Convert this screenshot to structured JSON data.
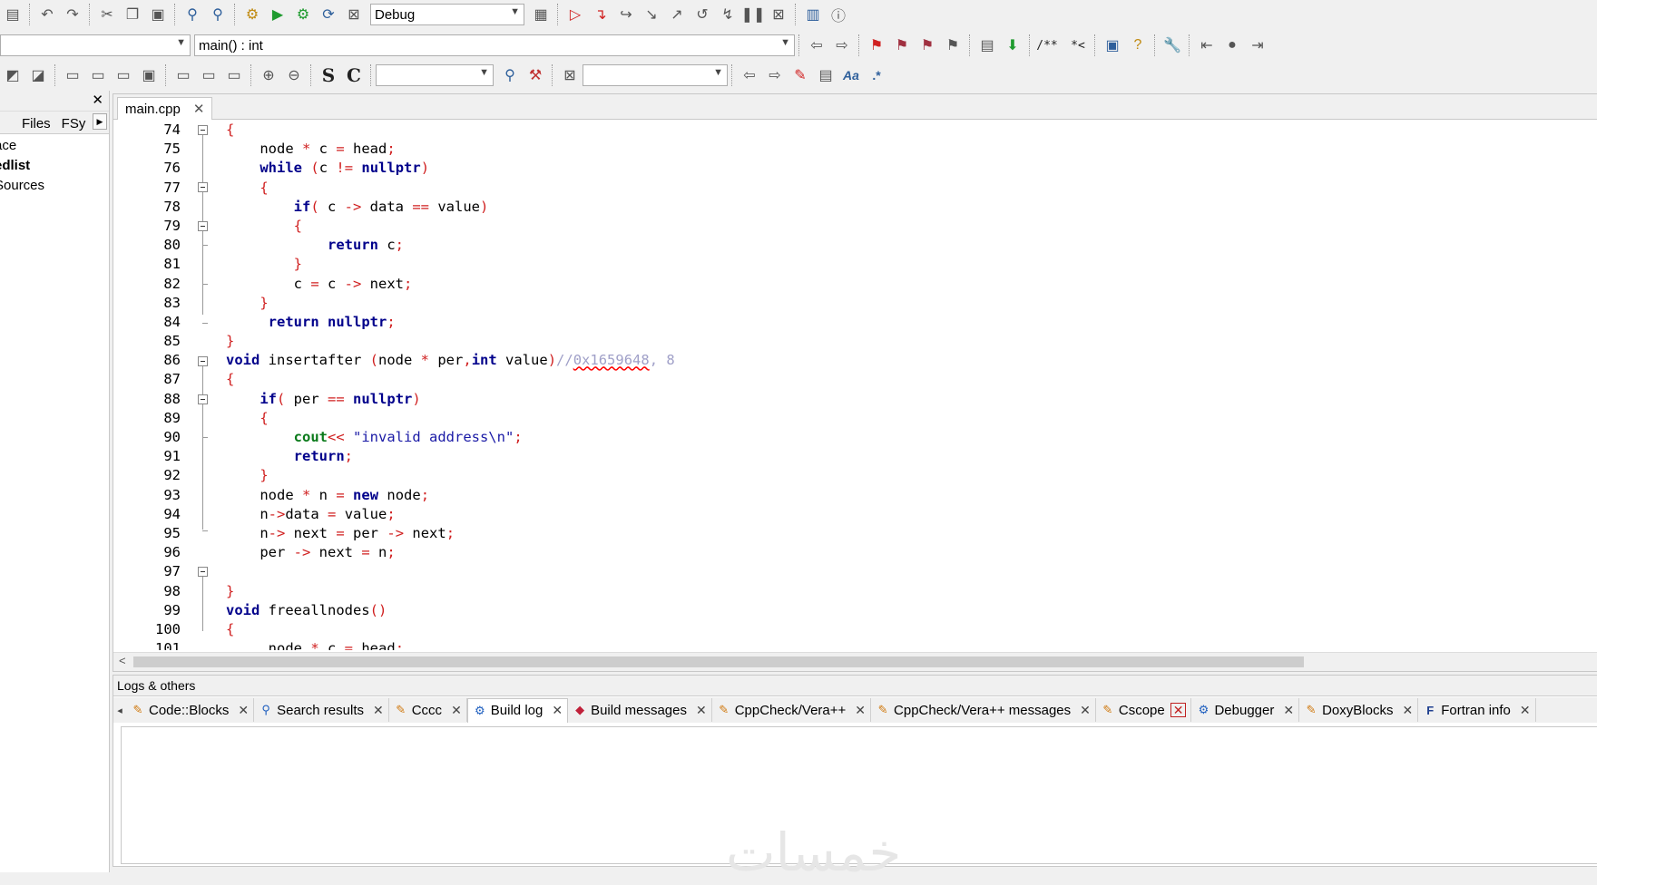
{
  "toolbar1": {
    "build_target": "Debug",
    "icons": [
      "save-all-icon",
      "undo-icon",
      "redo-icon",
      "cut-icon",
      "copy-icon",
      "paste-icon",
      "find-icon",
      "replace-icon",
      "build-icon",
      "run-icon",
      "build-run-icon",
      "rebuild-icon",
      "abort-icon",
      "target-options-icon",
      "debug-icon",
      "run-to-cursor-icon",
      "next-line-icon",
      "step-into-icon",
      "step-out-icon",
      "next-instruction-icon",
      "step-into-instruction-icon",
      "break-debugger-icon",
      "stop-debugger-icon",
      "debug-windows-icon",
      "debug-info-icon"
    ]
  },
  "toolbar2": {
    "scope_value": "",
    "function_value": "main() : int",
    "comment_button_1": "/**",
    "comment_button_2": "*<"
  },
  "toolbar3": {
    "text_s": "S",
    "text_c": "C",
    "search_value": "",
    "replace_value": "",
    "regex_label": "Aa",
    "regex_dot": ".*"
  },
  "left_panel": {
    "tabs": [
      "Files",
      "FSy"
    ],
    "tree": [
      "ace",
      "edlist",
      "Sources"
    ]
  },
  "editor": {
    "tab_label": "main.cpp",
    "line_numbers": [
      "74",
      "75",
      "76",
      "77",
      "78",
      "79",
      "80",
      "81",
      "82",
      "83",
      "84",
      "85",
      "86",
      "87",
      "88",
      "89",
      "90",
      "91",
      "92",
      "93",
      "94",
      "95",
      "96",
      "97",
      "98",
      "99",
      "100",
      "101"
    ]
  },
  "logs": {
    "title": "Logs & others",
    "tabs": [
      {
        "label": "Code::Blocks",
        "icon": "pencil-icon"
      },
      {
        "label": "Search results",
        "icon": "magnifier-icon"
      },
      {
        "label": "Cccc",
        "icon": "pencil-icon"
      },
      {
        "label": "Build log",
        "icon": "gear-icon"
      },
      {
        "label": "Build messages",
        "icon": "pin-icon"
      },
      {
        "label": "CppCheck/Vera++",
        "icon": "pencil-icon"
      },
      {
        "label": "CppCheck/Vera++ messages",
        "icon": "pencil-icon"
      },
      {
        "label": "Cscope",
        "icon": "pencil-icon"
      },
      {
        "label": "Debugger",
        "icon": "gear-icon"
      },
      {
        "label": "DoxyBlocks",
        "icon": "pencil-icon"
      },
      {
        "label": "Fortran info",
        "icon": "f-icon"
      }
    ],
    "active_tab": "Build log"
  },
  "watermark": "خمسات",
  "colors": {
    "keyword": "#00008b",
    "operator": "#d02020",
    "string": "#1a1aa6",
    "comment": "#a0a0c8"
  }
}
